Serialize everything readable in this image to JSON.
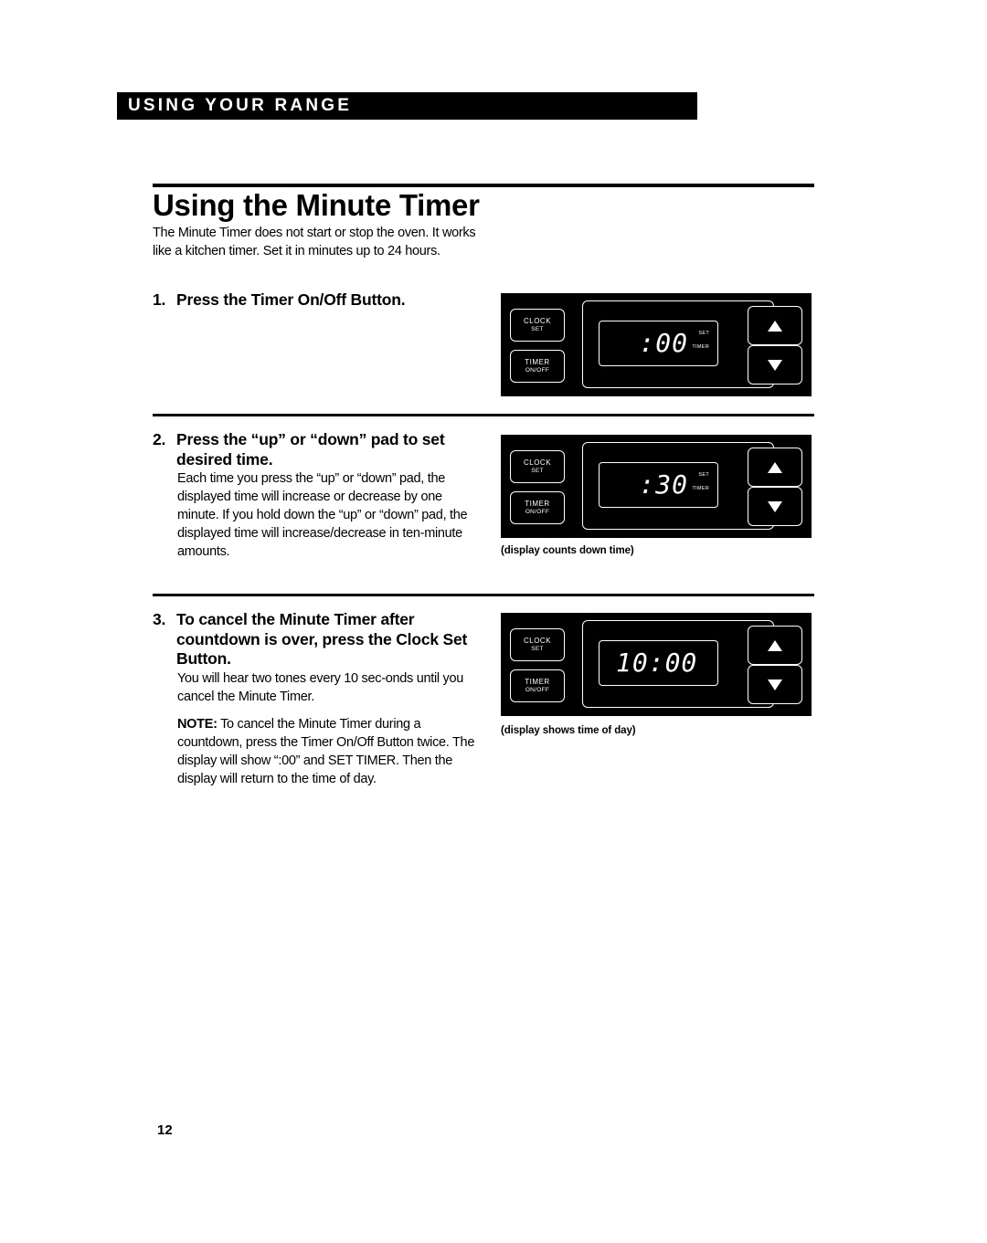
{
  "header": {
    "section_banner": "USING YOUR RANGE"
  },
  "page": {
    "title": "Using the Minute Timer",
    "intro": "The Minute Timer does not start or stop the oven. It works like a kitchen timer. Set it in minutes up to 24 hours.",
    "page_number": "12"
  },
  "steps": [
    {
      "number": "1.",
      "heading": "Press the Timer On/Off Button.",
      "body": "",
      "panel": {
        "clock_label_1": "CLOCK",
        "clock_label_2": "SET",
        "timer_label_1": "TIMER",
        "timer_label_2": "ON/OFF",
        "display": ":00",
        "indicator_set": "SET",
        "indicator_timer": "TIMER",
        "up_icon": "triangle-up",
        "down_icon": "triangle-down"
      },
      "caption": ""
    },
    {
      "number": "2.",
      "heading": "Press the “up” or “down” pad to set desired time.",
      "body": "Each time you press the “up” or “down” pad, the displayed time will increase or decrease by one minute. If you hold down the “up” or “down” pad, the displayed time will increase/decrease in ten-minute amounts.",
      "panel": {
        "clock_label_1": "CLOCK",
        "clock_label_2": "SET",
        "timer_label_1": "TIMER",
        "timer_label_2": "ON/OFF",
        "display": ":30",
        "indicator_set": "SET",
        "indicator_timer": "TIMER",
        "up_icon": "triangle-up",
        "down_icon": "triangle-down"
      },
      "caption": "(display counts down time)"
    },
    {
      "number": "3.",
      "heading": "To cancel the Minute Timer after countdown is over, press the Clock Set Button.",
      "body": "You will hear two tones every 10 sec-onds until you cancel the Minute Timer.",
      "note_label": "NOTE:",
      "note": " To cancel the Minute Timer during a countdown, press the Timer On/Off Button twice. The display will show “:00” and SET TIMER. Then the display will return to the time of day.",
      "panel": {
        "clock_label_1": "CLOCK",
        "clock_label_2": "SET",
        "timer_label_1": "TIMER",
        "timer_label_2": "ON/OFF",
        "display": "10:00",
        "up_icon": "triangle-up",
        "down_icon": "triangle-down"
      },
      "caption": "(display shows time of day)"
    }
  ]
}
